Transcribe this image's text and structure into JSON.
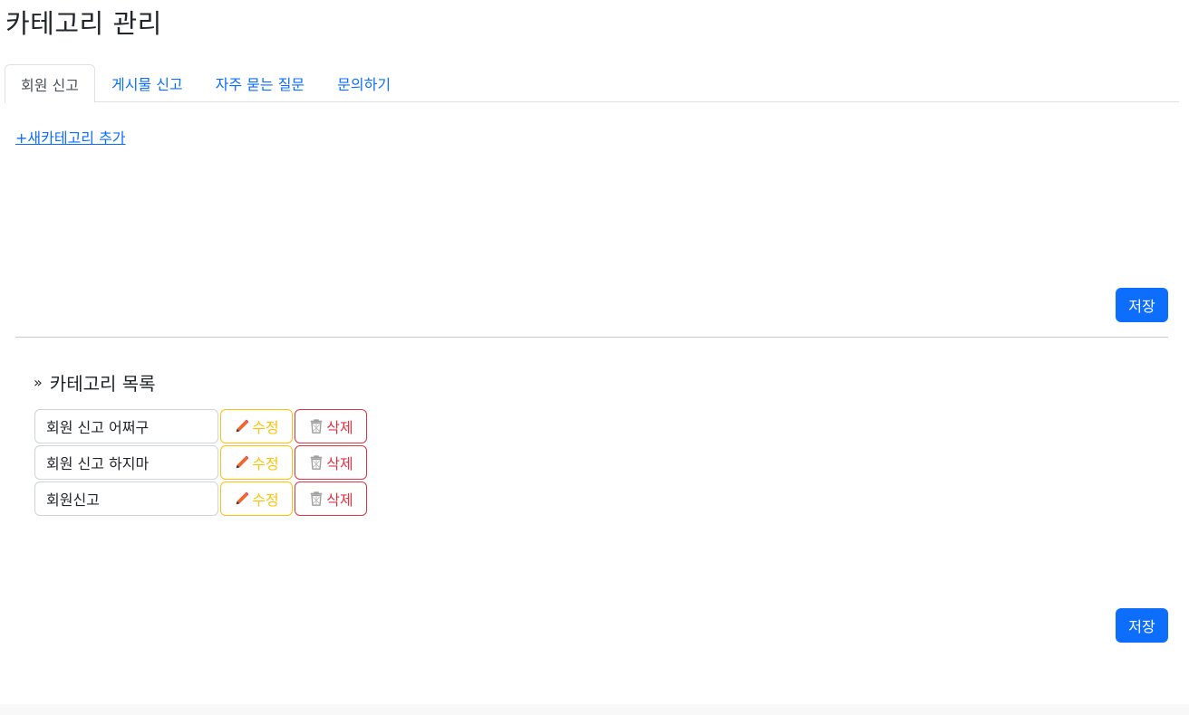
{
  "page": {
    "title": "카테고리 관리"
  },
  "tabs": [
    {
      "label": "회원 신고",
      "active": true
    },
    {
      "label": "게시물 신고",
      "active": false
    },
    {
      "label": "자주 묻는 질문",
      "active": false
    },
    {
      "label": "문의하기",
      "active": false
    }
  ],
  "add_category_link": "+새카테고리 추가",
  "save_label": "저장",
  "list": {
    "heading_prefix": "»",
    "heading": "카테고리 목록",
    "edit_label": "수정",
    "delete_label": "삭제",
    "edit_icon": "pencil-icon",
    "delete_icon": "trash-icon",
    "items": [
      {
        "name": "회원 신고 어쩌구"
      },
      {
        "name": "회원 신고 하지마"
      },
      {
        "name": "회원신고"
      }
    ]
  },
  "colors": {
    "primary": "#0d6efd",
    "warning": "#ffc107",
    "danger": "#dc3545",
    "pencil": "#f0662e",
    "trash": "#9e9e9e"
  }
}
